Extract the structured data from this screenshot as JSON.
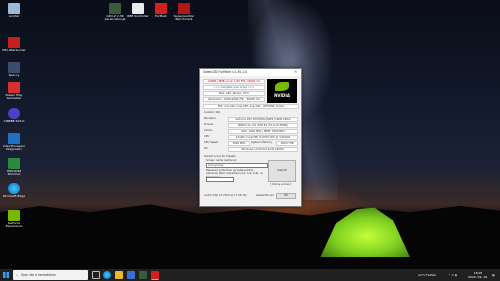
{
  "desktop": {
    "icons": [
      {
        "label": "Lomtár"
      },
      {
        "label": "MSI Afterburner"
      },
      {
        "label": "Speccy"
      },
      {
        "label": "Steam Play Gamestar"
      },
      {
        "label": "CINEBE R23.0"
      },
      {
        "label": "Intel Processor Diagnostic"
      },
      {
        "label": "HWinfo64 Shortcut"
      },
      {
        "label": "Microsoft Edge"
      },
      {
        "label": "GeForce Experience"
      },
      {
        "label": "GPU-Z 2.36 parancsikonja"
      },
      {
        "label": "RBE Kontroller"
      },
      {
        "label": "FurMark"
      },
      {
        "label": "Superposition Benchmark"
      }
    ]
  },
  "dialog": {
    "title": "Geeks3D FurMark v1.30.1.0",
    "logo_text": "NVIDIA",
    "score_line": "GOMB | NMB score: 1/20 FPS, 40000 ms",
    "compare_link": ">>> Compare your score <<<",
    "resolution_line": "Max: 240, Temps: 79°C",
    "duration_line": "Resolution: 1920x1080 (FS) - 60000 ms",
    "fps_line": "FPS: min:220, max:255, avg:240 - OPTIONS: FullAA",
    "custom": "Custom: N/A",
    "rows": [
      {
        "label": "Renderer",
        "value": "GeForce RTX 3070/PCIe/SSE2 (10DE-2484)"
      },
      {
        "label": "Drivers",
        "value": "NVIDIA GL 4.6 (536.99 (31.0.15.3699))"
      },
      {
        "label": "Clocks",
        "value": "GPU: 1920 MHz | MEM: 7000 MHz"
      },
      {
        "label": "CPU",
        "value": "Intel(R) Core(TM) i7-9700 CPU @ 3.00GHz"
      }
    ],
    "cpu_speed_label": "CPU Speed",
    "cpu_speed_value": "3000 MHz",
    "sysmem_label": "System Memory",
    "sysmem_value": "16327 MB",
    "os_label": "OS",
    "os_value": "Windows 10 (64-bit build 19045)",
    "submit_label": "Submit score for Presets",
    "screen_name_label": "Screen name (optional)",
    "screen_name_value": "Anonymous",
    "password_text": "Password protection (private submit - optional). MAX characters (a-z, A-Z, 0-9), no blank spac",
    "online_scores": "[ Online scores ]",
    "submit_button": "Submit",
    "footer_date": "Audit: (Feb 13 2024 @ 17:55:10)",
    "footer_link": "Geeks3D.com",
    "ok_button": "OK"
  },
  "taskbar": {
    "search_placeholder": "Írjon ide a kereséshez",
    "weather": "12°C Felhős",
    "time": "18:05",
    "date": "2024. 09. 16."
  }
}
